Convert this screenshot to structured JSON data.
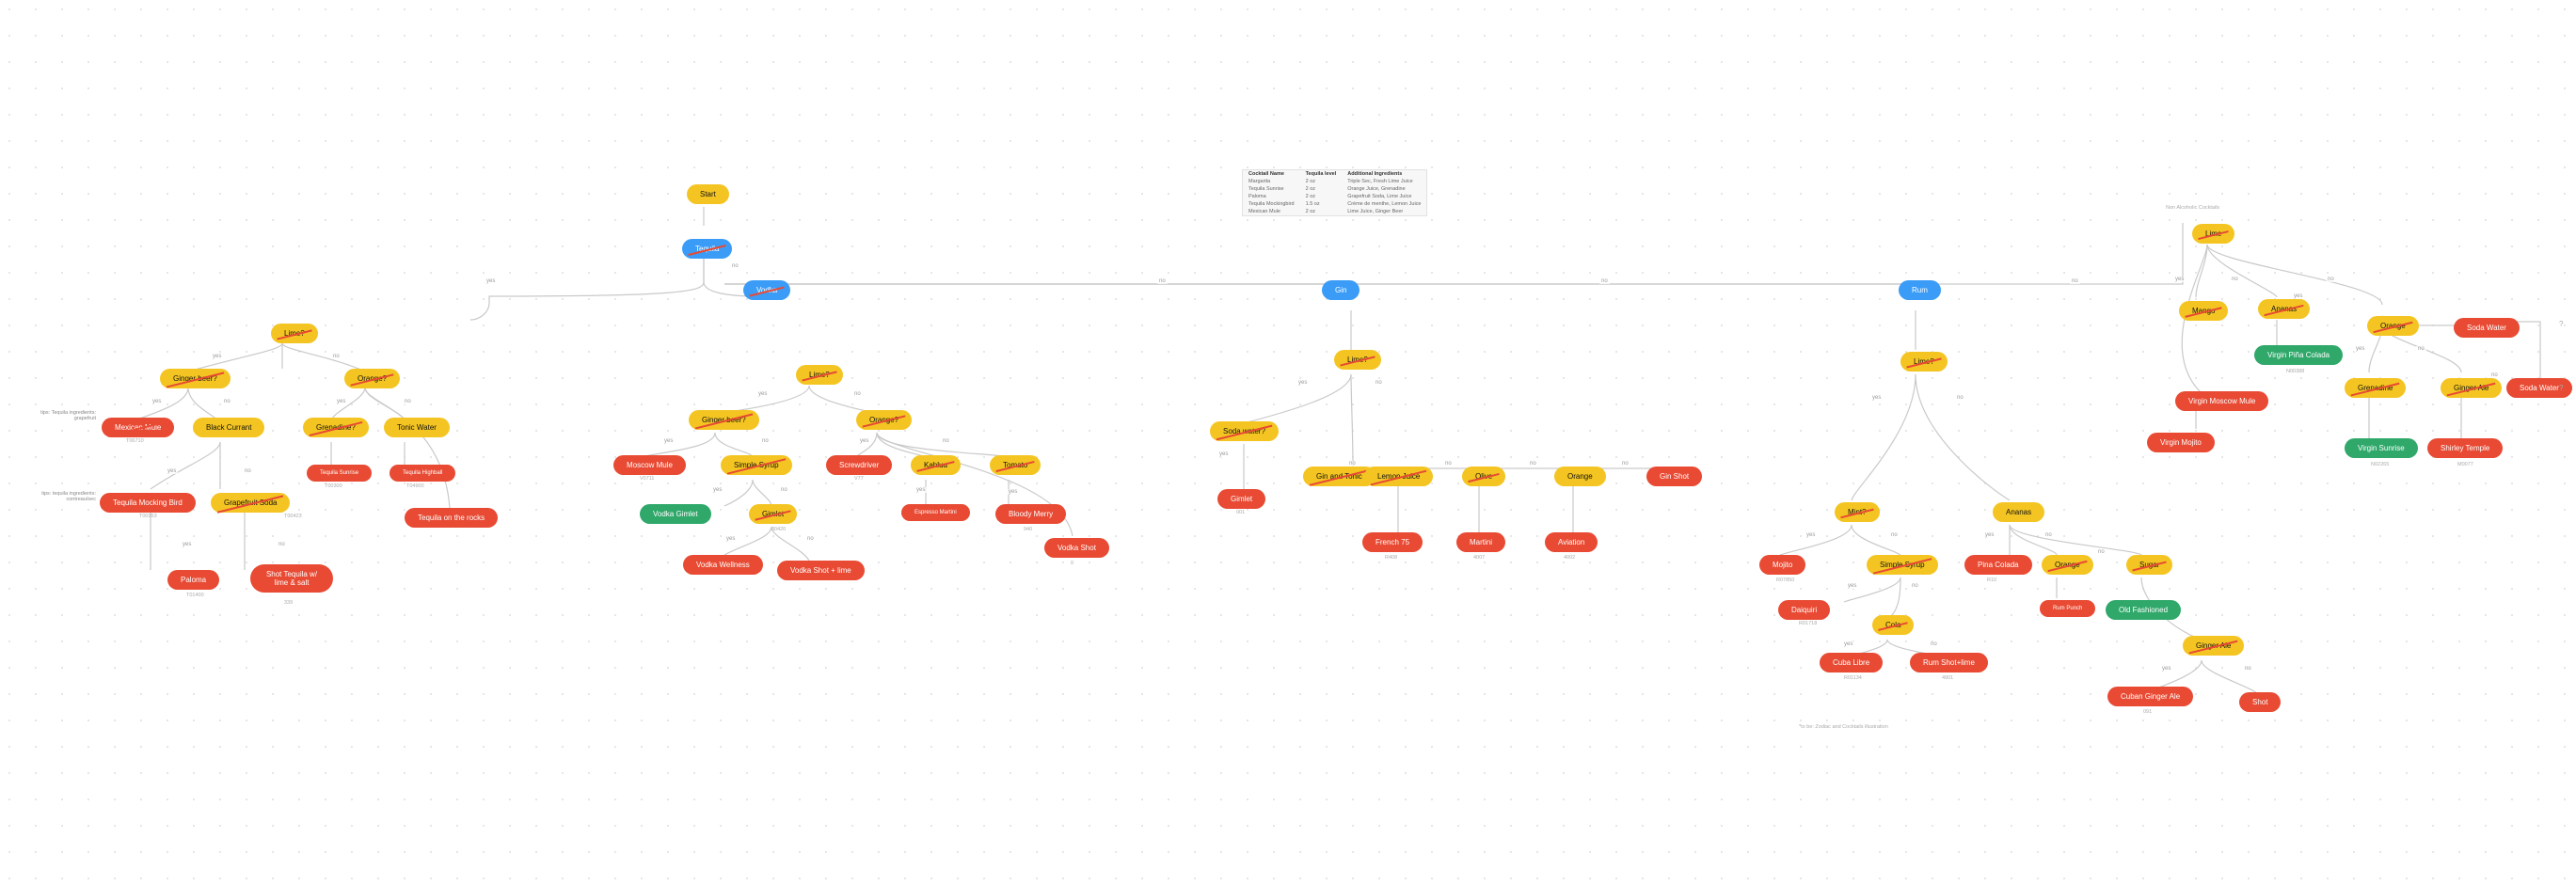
{
  "title_note": "Non Alcoholic Cocktails",
  "footer_note": "*to be: Zodiac and Cocktails illustration",
  "side_notes": {
    "tequila_note": "tips: Tequila\ningredients: grapefruit",
    "montequila_shot_note": "tips: tequila\ningredients: contreau/sec"
  },
  "legend": {
    "headers": [
      "Cocktail Name",
      "Tequila level",
      "Additional Ingredients"
    ],
    "rows": [
      [
        "Margarita",
        "2 oz",
        "Triple Sec, Fresh Lime Juice"
      ],
      [
        "Tequila Sunrise",
        "2 oz",
        "Orange Juice, Grenadine"
      ],
      [
        "Paloma",
        "2 oz",
        "Grapefruit Soda, Lime Juice"
      ],
      [
        "Tequila Mockingbird",
        "1.5 oz",
        "Crème de menthe, Lemon Juice"
      ],
      [
        "Mexican Mule",
        "2 oz",
        "Lime Juice, Ginger Beer"
      ]
    ]
  },
  "root": {
    "label": "Start"
  },
  "branches": {
    "tequila": {
      "label": "Tequila"
    },
    "vodka": {
      "label": "Vodka"
    },
    "gin": {
      "label": "Gin"
    },
    "rum": {
      "label": "Rum"
    },
    "nonalc_lime": {
      "label": "Lime"
    }
  },
  "edge_yes": "yes",
  "edge_no": "no",
  "tequila": {
    "lime_q": "Lime?",
    "ginger_q": "Ginger beer?",
    "orange_q": "Orange?",
    "mexican_mule": "Mexican Mule",
    "black_currant": "Black Currant",
    "grenadine_q": "Grenadine?",
    "tonic_q": "Tonic Water",
    "tequila_sunrise": "Tequila Sunrise",
    "tequila_highball": "Tequila Highball",
    "tequila_rocks": "Tequila on the rocks",
    "tmb": "Tequila Mocking Bird",
    "gf_soda": "Grapefruit Soda",
    "paloma": "Paloma",
    "shot_tequila": "Shot Tequila w/ lime & salt",
    "id_tmb": "T00353",
    "id_pal": "T01400",
    "id_shot": "339",
    "id_gf": "T00423",
    "id_sun": "T00300",
    "id_hb": "T04900",
    "id_mm": "T06710"
  },
  "vodka": {
    "lime_q": "Lime?",
    "ginger_q": "Ginger beer?",
    "orange_q": "Orange?",
    "moscow_mule": "Moscow Mule",
    "simple_syrup": "Simple Syrup",
    "gimlet": "Gimlet",
    "vodka_gimlet": "Vodka Gimlet",
    "screwdriver": "Screwdriver",
    "kahlua": "Kahlua",
    "tomato": "Tomato",
    "esp_martini": "Espresso Martini",
    "bloody": "Bloody Merry",
    "vodka_shot_lime": "Vodka Shot + lime",
    "vodka_wellness": "Vodka Wellness",
    "vodka_shot": "Vodka Shot",
    "id_mm": "V0711",
    "id_sc": "V77",
    "id_vs": "0",
    "id_bm": "940",
    "id_gim": "-30420"
  },
  "gin": {
    "lime_q": "Lime?",
    "soda_q": "Soda water?",
    "gt": "Gin and Tonic",
    "lemon_juice": "Lemon Juice",
    "olive": "Olive",
    "orange": "Orange",
    "gimlet": "Gimlet",
    "french75": "French 75",
    "martini": "Martini",
    "aviation": "Aviation",
    "gin_shot": "Gin Shot",
    "id_gim": "001",
    "id_f75": "R408",
    "id_mar": "4007",
    "id_av": "4002"
  },
  "rum": {
    "lime_q": "Lime?",
    "mint_q": "Mint?",
    "ananas_q": "Ananas",
    "simple_syrup": "Simple Syrup",
    "mojito": "Mojito",
    "daiquiri": "Daiquiri",
    "cola": "Cola",
    "cuba_libre": "Cuba Libre",
    "rum_shot_lime": "Rum Shot+lime",
    "pina_colada": "Pina Colada",
    "orange_q": "Orange",
    "sugar_q": "Sugar",
    "rum_punch": "Rum Punch",
    "old_fashioned": "Old Fashioned",
    "ginger_ale": "Ginger Ale",
    "cuban_ga": "Cuban Ginger Ale",
    "shot": "Shot",
    "id_moj": "R07850",
    "id_daq": "R01718",
    "id_cl": "R01134",
    "id_rsl": "4901",
    "id_pc": "R10",
    "id_cga": "091"
  },
  "nonalc": {
    "lime": "Lime",
    "mango": "Mango",
    "ananas": "Ananas",
    "orange": "Orange",
    "soda1": "Soda Water",
    "soda2": "Soda Water",
    "virgin_pc": "Virgin Piña Colada",
    "virgin_mm": "Virgin Moscow Mule",
    "virgin_mojito": "Virgin Mojito",
    "grenadine": "Grenadine",
    "ginger_ale": "Ginger Ale",
    "virgin_sunrise": "Virgin Sunrise",
    "shirley_temple": "Shirley Temple",
    "id_vpc": "N00388",
    "id_vs": "N02265",
    "id_st": "M0077"
  }
}
